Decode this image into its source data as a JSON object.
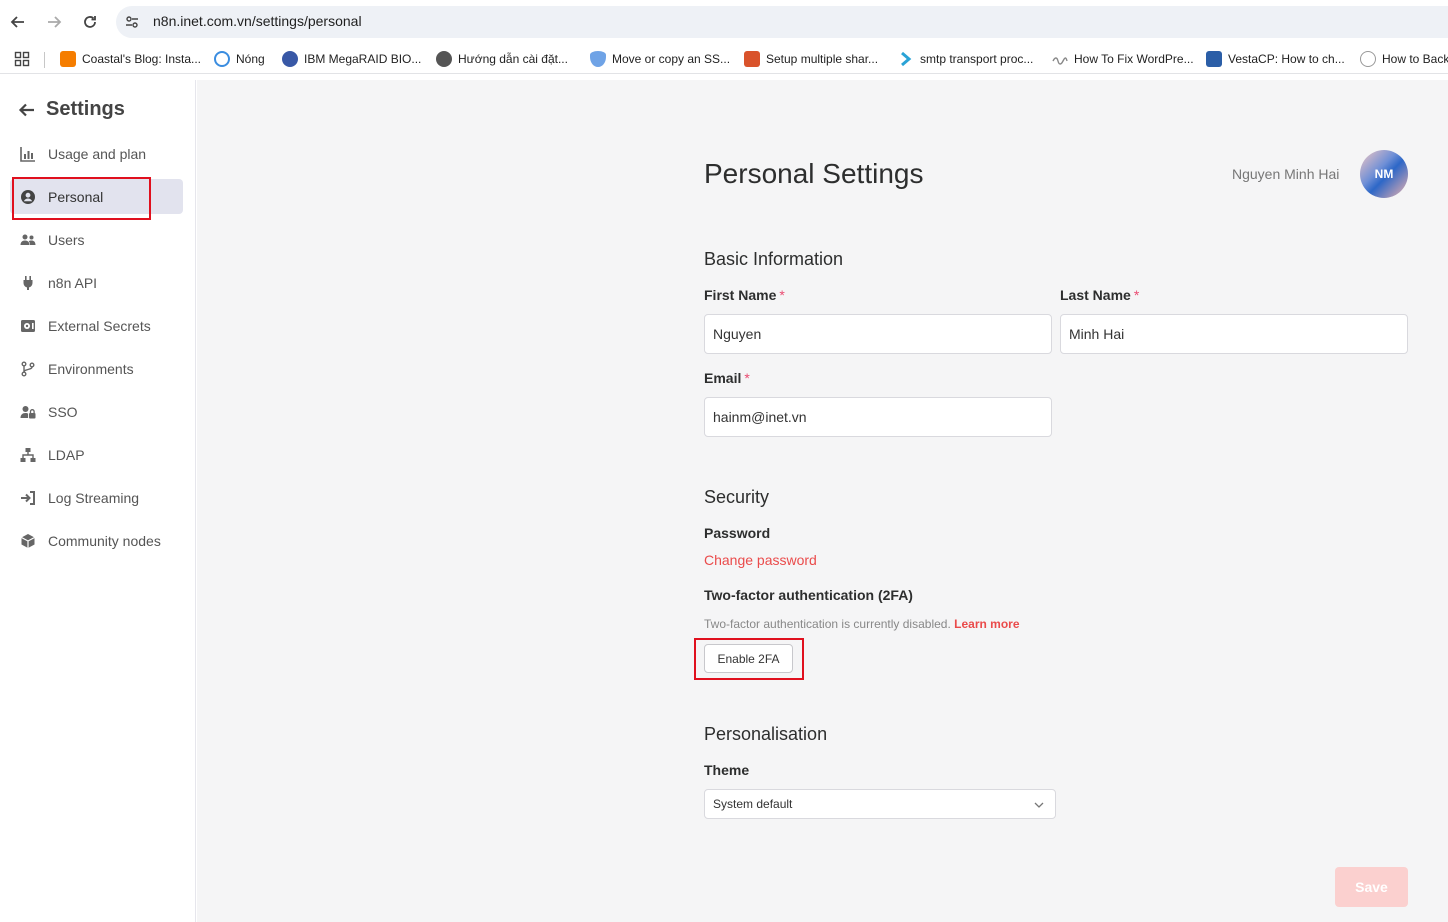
{
  "browser": {
    "url": "n8n.inet.com.vn/settings/personal",
    "bookmarks": [
      {
        "label": "Coastal's Blog: Insta...",
        "icon": "blogger-icon",
        "color": "#f57d00"
      },
      {
        "label": "Nóng",
        "icon": "clock-icon",
        "color": "#3b8de0"
      },
      {
        "label": "IBM MegaRAID BIO...",
        "icon": "wordpress-icon",
        "color": "#3858a6"
      },
      {
        "label": "Hướng dẫn cài đặt...",
        "icon": "globe-icon",
        "color": "#555555"
      },
      {
        "label": "Move or copy an SS...",
        "icon": "shield-icon",
        "color": "#6fa3e6"
      },
      {
        "label": "Setup multiple shar...",
        "icon": "sts-icon",
        "color": "#d9532b"
      },
      {
        "label": "smtp transport proc...",
        "icon": "arrow-icon",
        "color": "#2aa3d6"
      },
      {
        "label": "How To Fix WordPre...",
        "icon": "wave-icon",
        "color": "#888888"
      },
      {
        "label": "VestaCP: How to ch...",
        "icon": "ts-icon",
        "color": "#2b5ea7"
      },
      {
        "label": "How to Back",
        "icon": "cloud-icon",
        "color": "#999999"
      }
    ]
  },
  "sidebar": {
    "title": "Settings",
    "items": [
      {
        "label": "Usage and plan",
        "icon": "chart-icon"
      },
      {
        "label": "Personal",
        "icon": "user-circle-icon",
        "active": true
      },
      {
        "label": "Users",
        "icon": "users-icon"
      },
      {
        "label": "n8n API",
        "icon": "plug-icon"
      },
      {
        "label": "External Secrets",
        "icon": "vault-icon"
      },
      {
        "label": "Environments",
        "icon": "branch-icon"
      },
      {
        "label": "SSO",
        "icon": "user-lock-icon"
      },
      {
        "label": "LDAP",
        "icon": "network-icon"
      },
      {
        "label": "Log Streaming",
        "icon": "sign-in-icon"
      },
      {
        "label": "Community nodes",
        "icon": "cube-icon"
      }
    ]
  },
  "main": {
    "title": "Personal Settings",
    "user": {
      "name": "Nguyen Minh Hai",
      "initials": "NM"
    },
    "basic": {
      "title": "Basic Information",
      "first_name_label": "First Name",
      "first_name": "Nguyen",
      "last_name_label": "Last Name",
      "last_name": "Minh Hai",
      "email_label": "Email",
      "email": "hainm@inet.vn",
      "required_mark": "*"
    },
    "security": {
      "title": "Security",
      "password_label": "Password",
      "change_password": "Change password",
      "twofa_label": "Two-factor authentication (2FA)",
      "twofa_desc": "Two-factor authentication is currently disabled.",
      "learn_more": "Learn more",
      "enable_2fa": "Enable 2FA"
    },
    "personalisation": {
      "title": "Personalisation",
      "theme_label": "Theme",
      "theme_value": "System default"
    },
    "save_label": "Save"
  },
  "colors": {
    "accent": "#ea4b4b",
    "highlight_box": "#e0101e",
    "save_disabled": "#fbd0cf"
  }
}
